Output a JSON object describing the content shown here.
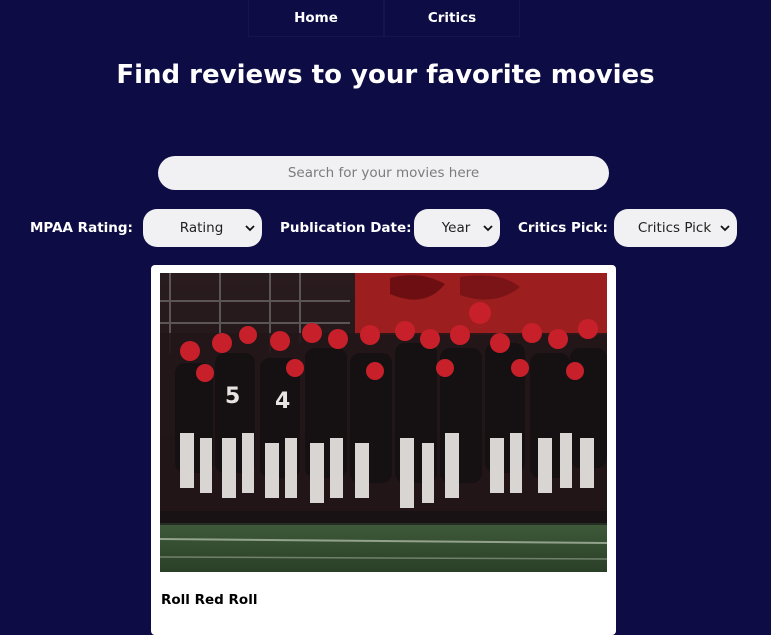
{
  "nav": {
    "items": [
      {
        "label": "Home"
      },
      {
        "label": "Critics"
      }
    ]
  },
  "page": {
    "title": "Find reviews to your favorite movies"
  },
  "search": {
    "placeholder": "Search for your movies here"
  },
  "filters": {
    "mpaa_label": "MPAA Rating:",
    "mpaa_value": "Rating",
    "date_label": "Publication Date:",
    "date_value": "Year",
    "critics_label": "Critics Pick:",
    "critics_value": "Critics Pick"
  },
  "results": [
    {
      "title": "Roll Red Roll",
      "image": "football-team-photo"
    }
  ],
  "colors": {
    "background": "#0d0c45",
    "control": "#f1f0f2",
    "card": "#ffffff"
  }
}
